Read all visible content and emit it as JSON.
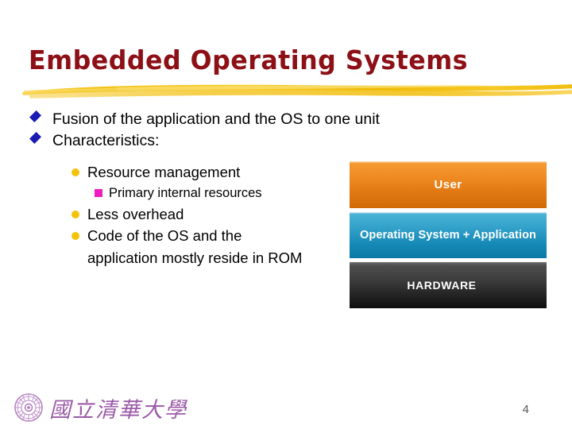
{
  "slide": {
    "title": "Embedded Operating Systems",
    "page_number": "4",
    "title_color": "#8c1016",
    "brush_color": "#f5c31a"
  },
  "bullets": {
    "level1": [
      {
        "text": "Fusion of the application and the OS to one unit",
        "marker": "diamond",
        "marker_color": "#1a1ab4"
      },
      {
        "text": "Characteristics:",
        "marker": "diamond",
        "marker_color": "#1a1ab4"
      }
    ],
    "level2": [
      {
        "text": "Resource management",
        "marker": "circle",
        "marker_color": "#f5c20a"
      },
      {
        "text": "Less overhead",
        "marker": "circle",
        "marker_color": "#f5c20a"
      },
      {
        "text": "Code of the OS and the application mostly reside in ROM",
        "marker": "circle",
        "marker_color": "#f5c20a"
      }
    ],
    "level3": [
      {
        "text": "Primary internal resources",
        "marker": "square",
        "marker_color": "#ee1ec0"
      }
    ]
  },
  "diagram": {
    "name": "system-stack",
    "layers": [
      {
        "label": "User",
        "fill_top": "#f59a32",
        "fill_bottom": "#d16a06"
      },
      {
        "label": "Operating System + Application",
        "fill_top": "#4bb2d6",
        "fill_bottom": "#0a7aa5"
      },
      {
        "label": "HARDWARE",
        "fill_top": "#4d4d4d",
        "fill_bottom": "#0e0e0e"
      }
    ]
  },
  "footer": {
    "logo_text": "國立清華大學",
    "logo_color": "#9b5ba8"
  }
}
